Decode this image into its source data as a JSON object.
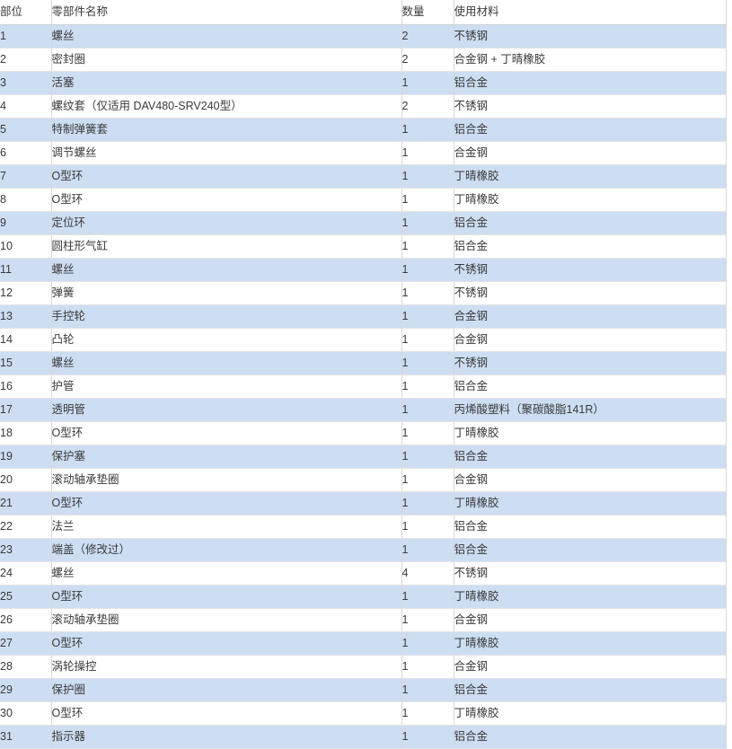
{
  "table": {
    "columns": [
      {
        "key": "position",
        "label": "部位"
      },
      {
        "key": "name",
        "label": "零部件名称"
      },
      {
        "key": "quantity",
        "label": "数量"
      },
      {
        "key": "material",
        "label": "使用材料"
      }
    ],
    "colors": {
      "row_shaded_bg": "#cddef3",
      "row_plain_bg": "#ffffff",
      "border": "#d7d7d7",
      "text": "#3a3a3a"
    },
    "rows": [
      {
        "position": "1",
        "name": "螺丝",
        "quantity": "2",
        "material": "不锈钢",
        "shaded": true,
        "indent_name": "none",
        "indent_mat": "none"
      },
      {
        "position": "2",
        "name": "密封圈",
        "quantity": "2",
        "material": "合金钢 + 丁晴橡胶",
        "shaded": false,
        "indent_name": "none",
        "indent_mat": "none"
      },
      {
        "position": "3",
        "name": "活塞",
        "quantity": "1",
        "material": "铝合金",
        "shaded": true,
        "indent_name": "none",
        "indent_mat": "small"
      },
      {
        "position": "4",
        "name": "螺纹套（仅适用 DAV480-SRV240型）",
        "quantity": "2",
        "material": "不锈钢",
        "shaded": false,
        "indent_name": "none",
        "indent_mat": "none"
      },
      {
        "position": "5",
        "name": "特制弹簧套",
        "quantity": "1",
        "material": "铝合金",
        "shaded": true,
        "indent_name": "none",
        "indent_mat": "none"
      },
      {
        "position": "6",
        "name": "调节螺丝",
        "quantity": "1",
        "material": "合金钢",
        "shaded": false,
        "indent_name": "none",
        "indent_mat": "small"
      },
      {
        "position": "7",
        "name": "O型环",
        "quantity": "1",
        "material": "丁晴橡胶",
        "shaded": true,
        "indent_name": "small",
        "indent_mat": "none"
      },
      {
        "position": "8",
        "name": "O型环",
        "quantity": "1",
        "material": "丁晴橡胶",
        "shaded": false,
        "indent_name": "small",
        "indent_mat": "none"
      },
      {
        "position": "9",
        "name": "定位环",
        "quantity": "1",
        "material": "铝合金",
        "shaded": true,
        "indent_name": "none",
        "indent_mat": "small"
      },
      {
        "position": "10",
        "name": "圆柱形气缸",
        "quantity": "1",
        "material": "铝合金",
        "shaded": false,
        "indent_name": "none",
        "indent_mat": "none"
      },
      {
        "position": "11",
        "name": "螺丝",
        "quantity": "1",
        "material": "不锈钢",
        "shaded": true,
        "indent_name": "none",
        "indent_mat": "small"
      },
      {
        "position": "12",
        "name": "弹簧",
        "quantity": "1",
        "material": "不锈钢",
        "shaded": false,
        "indent_name": "small",
        "indent_mat": "none"
      },
      {
        "position": "13",
        "name": "手控轮",
        "quantity": "1",
        "material": "合金钢",
        "shaded": true,
        "indent_name": "none",
        "indent_mat": "none"
      },
      {
        "position": "14",
        "name": "凸轮",
        "quantity": "1",
        "material": "合金钢",
        "shaded": false,
        "indent_name": "none",
        "indent_mat": "none"
      },
      {
        "position": "15",
        "name": "螺丝",
        "quantity": "1",
        "material": "不锈钢",
        "shaded": true,
        "indent_name": "none",
        "indent_mat": "none"
      },
      {
        "position": "16",
        "name": "护管",
        "quantity": "1",
        "material": "铝合金",
        "shaded": false,
        "indent_name": "none",
        "indent_mat": "none"
      },
      {
        "position": "17",
        "name": "透明管",
        "quantity": "1",
        "material": "丙烯酸塑料（聚碳酸脂141R）",
        "shaded": true,
        "indent_name": "none",
        "indent_mat": "none"
      },
      {
        "position": "18",
        "name": "O型环",
        "quantity": "1",
        "material": "丁晴橡胶",
        "shaded": false,
        "indent_name": "small",
        "indent_mat": "none"
      },
      {
        "position": "19",
        "name": "保护塞",
        "quantity": "1",
        "material": "铝合金",
        "shaded": true,
        "indent_name": "none",
        "indent_mat": "small"
      },
      {
        "position": "20",
        "name": "滚动轴承垫圈",
        "quantity": "1",
        "material": "合金钢",
        "shaded": false,
        "indent_name": "none",
        "indent_mat": "small"
      },
      {
        "position": "21",
        "name": "O型环",
        "quantity": "1",
        "material": "丁晴橡胶",
        "shaded": true,
        "indent_name": "small",
        "indent_mat": "small"
      },
      {
        "position": "22",
        "name": "法兰",
        "quantity": "1",
        "material": "铝合金",
        "shaded": false,
        "indent_name": "none",
        "indent_mat": "none"
      },
      {
        "position": "23",
        "name": "端盖（修改过）",
        "quantity": "1",
        "material": "铝合金",
        "shaded": true,
        "indent_name": "none",
        "indent_mat": "none"
      },
      {
        "position": "24",
        "name": "螺丝",
        "quantity": "4",
        "material": "不锈钢",
        "shaded": false,
        "indent_name": "none",
        "indent_mat": "none"
      },
      {
        "position": "25",
        "name": "O型环",
        "quantity": "1",
        "material": "丁晴橡胶",
        "shaded": true,
        "indent_name": "none",
        "indent_mat": "none"
      },
      {
        "position": "26",
        "name": "滚动轴承垫圈",
        "quantity": "1",
        "material": "合金钢",
        "shaded": false,
        "indent_name": "none",
        "indent_mat": "none"
      },
      {
        "position": "27",
        "name": "O型环",
        "quantity": "1",
        "material": "丁晴橡胶",
        "shaded": true,
        "indent_name": "small",
        "indent_mat": "none"
      },
      {
        "position": "28",
        "name": "涡轮操控",
        "quantity": "1",
        "material": "合金钢",
        "shaded": false,
        "indent_name": "none",
        "indent_mat": "none"
      },
      {
        "position": "29",
        "name": "保护圈",
        "quantity": "1",
        "material": "铝合金",
        "shaded": true,
        "indent_name": "none",
        "indent_mat": "small"
      },
      {
        "position": "30",
        "name": "O型环",
        "quantity": "1",
        "material": "丁晴橡胶",
        "shaded": false,
        "indent_name": "small",
        "indent_mat": "none"
      },
      {
        "position": "31",
        "name": "指示器",
        "quantity": "1",
        "material": "铝合金",
        "shaded": true,
        "indent_name": "none",
        "indent_mat": "small"
      }
    ]
  }
}
